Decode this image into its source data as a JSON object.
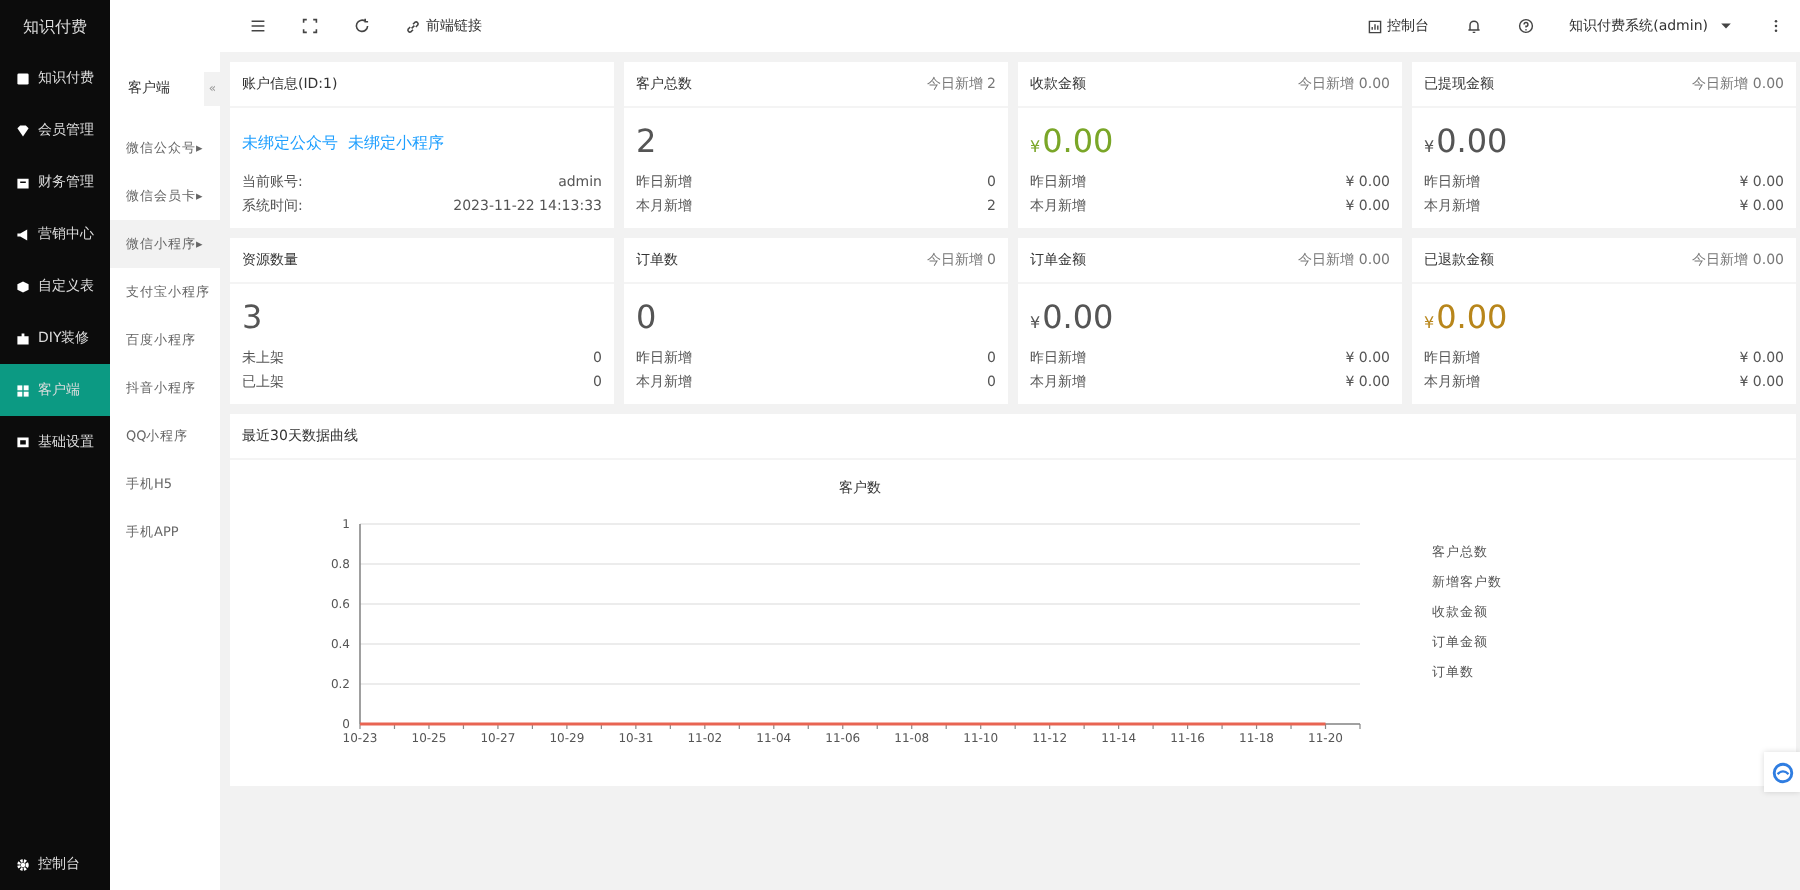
{
  "sidebar": {
    "title": "知识付费",
    "items": [
      {
        "label": "知识付费",
        "selected": false
      },
      {
        "label": "会员管理",
        "selected": false
      },
      {
        "label": "财务管理",
        "selected": false
      },
      {
        "label": "营销中心",
        "selected": false
      },
      {
        "label": "自定义表",
        "selected": false
      },
      {
        "label": "DIY装修",
        "selected": false
      },
      {
        "label": "客户端",
        "selected": true
      },
      {
        "label": "基础设置",
        "selected": false
      }
    ],
    "footer": "控制台"
  },
  "submenu": {
    "title": "客户端",
    "collapse": "«",
    "items": [
      {
        "label": "微信公众号",
        "arrow": "▸",
        "selected": false
      },
      {
        "label": "微信会员卡",
        "arrow": "▸",
        "selected": false
      },
      {
        "label": "微信小程序",
        "arrow": "▸",
        "selected": true
      },
      {
        "label": "支付宝小程序",
        "selected": false
      },
      {
        "label": "百度小程序",
        "selected": false
      },
      {
        "label": "抖音小程序",
        "selected": false
      },
      {
        "label": "QQ小程序",
        "selected": false
      },
      {
        "label": "手机H5",
        "selected": false
      },
      {
        "label": "手机APP",
        "selected": false
      }
    ]
  },
  "topbar": {
    "link": "前端链接",
    "console": "控制台",
    "user": "知识付费系统(admin)"
  },
  "cards": [
    {
      "kind": "account",
      "title": "账户信息(ID:1)",
      "links": [
        "未绑定公众号",
        "未绑定小程序"
      ],
      "rows": [
        {
          "label": "当前账号:",
          "value": "admin"
        },
        {
          "label": "系统时间:",
          "value": "2023-11-22 14:13:33"
        }
      ]
    },
    {
      "kind": "stat",
      "title": "客户总数",
      "badge": "今日新增 2",
      "value": "2",
      "color": "#555555",
      "rows": [
        {
          "label": "昨日新增",
          "value": "0"
        },
        {
          "label": "本月新增",
          "value": "2"
        }
      ]
    },
    {
      "kind": "stat",
      "title": "收款金额",
      "badge": "今日新增 0.00",
      "currency": "¥",
      "value": "0.00",
      "color": "#7aa628",
      "rows": [
        {
          "label": "昨日新增",
          "value": "¥ 0.00"
        },
        {
          "label": "本月新增",
          "value": "¥ 0.00"
        }
      ]
    },
    {
      "kind": "stat",
      "title": "已提现金额",
      "badge": "今日新增 0.00",
      "currency": "¥",
      "value": "0.00",
      "color": "#555555",
      "rows": [
        {
          "label": "昨日新增",
          "value": "¥ 0.00"
        },
        {
          "label": "本月新增",
          "value": "¥ 0.00"
        }
      ]
    },
    {
      "kind": "stat",
      "title": "资源数量",
      "value": "3",
      "color": "#555555",
      "rows": [
        {
          "label": "未上架",
          "value": "0"
        },
        {
          "label": "已上架",
          "value": "0"
        }
      ]
    },
    {
      "kind": "stat",
      "title": "订单数",
      "badge": "今日新增 0",
      "value": "0",
      "color": "#555555",
      "rows": [
        {
          "label": "昨日新增",
          "value": "0"
        },
        {
          "label": "本月新增",
          "value": "0"
        }
      ]
    },
    {
      "kind": "stat",
      "title": "订单金额",
      "badge": "今日新增 0.00",
      "currency": "¥",
      "value": "0.00",
      "color": "#555555",
      "rows": [
        {
          "label": "昨日新增",
          "value": "¥ 0.00"
        },
        {
          "label": "本月新增",
          "value": "¥ 0.00"
        }
      ]
    },
    {
      "kind": "stat",
      "title": "已退款金额",
      "badge": "今日新增 0.00",
      "currency": "¥",
      "value": "0.00",
      "color": "#b8861b",
      "rows": [
        {
          "label": "昨日新增",
          "value": "¥ 0.00"
        },
        {
          "label": "本月新增",
          "value": "¥ 0.00"
        }
      ]
    }
  ],
  "trend": {
    "title": "最近30天数据曲线",
    "chart_data": {
      "type": "line",
      "title": "客户数",
      "categories": [
        "10-23",
        "10-25",
        "10-27",
        "10-29",
        "10-31",
        "11-02",
        "11-04",
        "11-06",
        "11-08",
        "11-10",
        "11-12",
        "11-14",
        "11-16",
        "11-18",
        "11-20"
      ],
      "ylim": [
        0,
        1
      ],
      "grid": true,
      "yticks": [
        0,
        {
          "value": 0.2,
          "label": "0.2"
        },
        {
          "value": 0.4,
          "label": "0.4"
        },
        {
          "value": 0.6,
          "label": "0.6"
        },
        {
          "value": 0.8,
          "label": "0.8"
        },
        1
      ],
      "series": [
        {
          "name": "客户总数",
          "color": "#5b8ff9",
          "values": [
            null,
            null,
            null,
            null,
            null,
            null,
            null,
            null,
            null,
            null,
            null,
            null,
            null,
            null,
            null
          ]
        },
        {
          "name": "新增客户数",
          "color": "#5ad8a6",
          "values": [
            null,
            null,
            null,
            null,
            null,
            null,
            null,
            null,
            null,
            null,
            null,
            null,
            null,
            null,
            null
          ]
        },
        {
          "name": "收款金额",
          "color": "#f6bd16",
          "values": [
            null,
            null,
            null,
            null,
            null,
            null,
            null,
            null,
            null,
            null,
            null,
            null,
            null,
            null,
            null
          ]
        },
        {
          "name": "订单金额",
          "color": "#6dc8ec",
          "values": [
            null,
            null,
            null,
            null,
            null,
            null,
            null,
            null,
            null,
            null,
            null,
            null,
            null,
            null,
            null
          ]
        },
        {
          "name": "订单数",
          "color": "#e86452",
          "values": [
            0,
            0,
            0,
            0,
            0,
            0,
            0,
            0,
            0,
            0,
            0,
            0,
            0,
            0,
            0
          ]
        }
      ]
    }
  }
}
